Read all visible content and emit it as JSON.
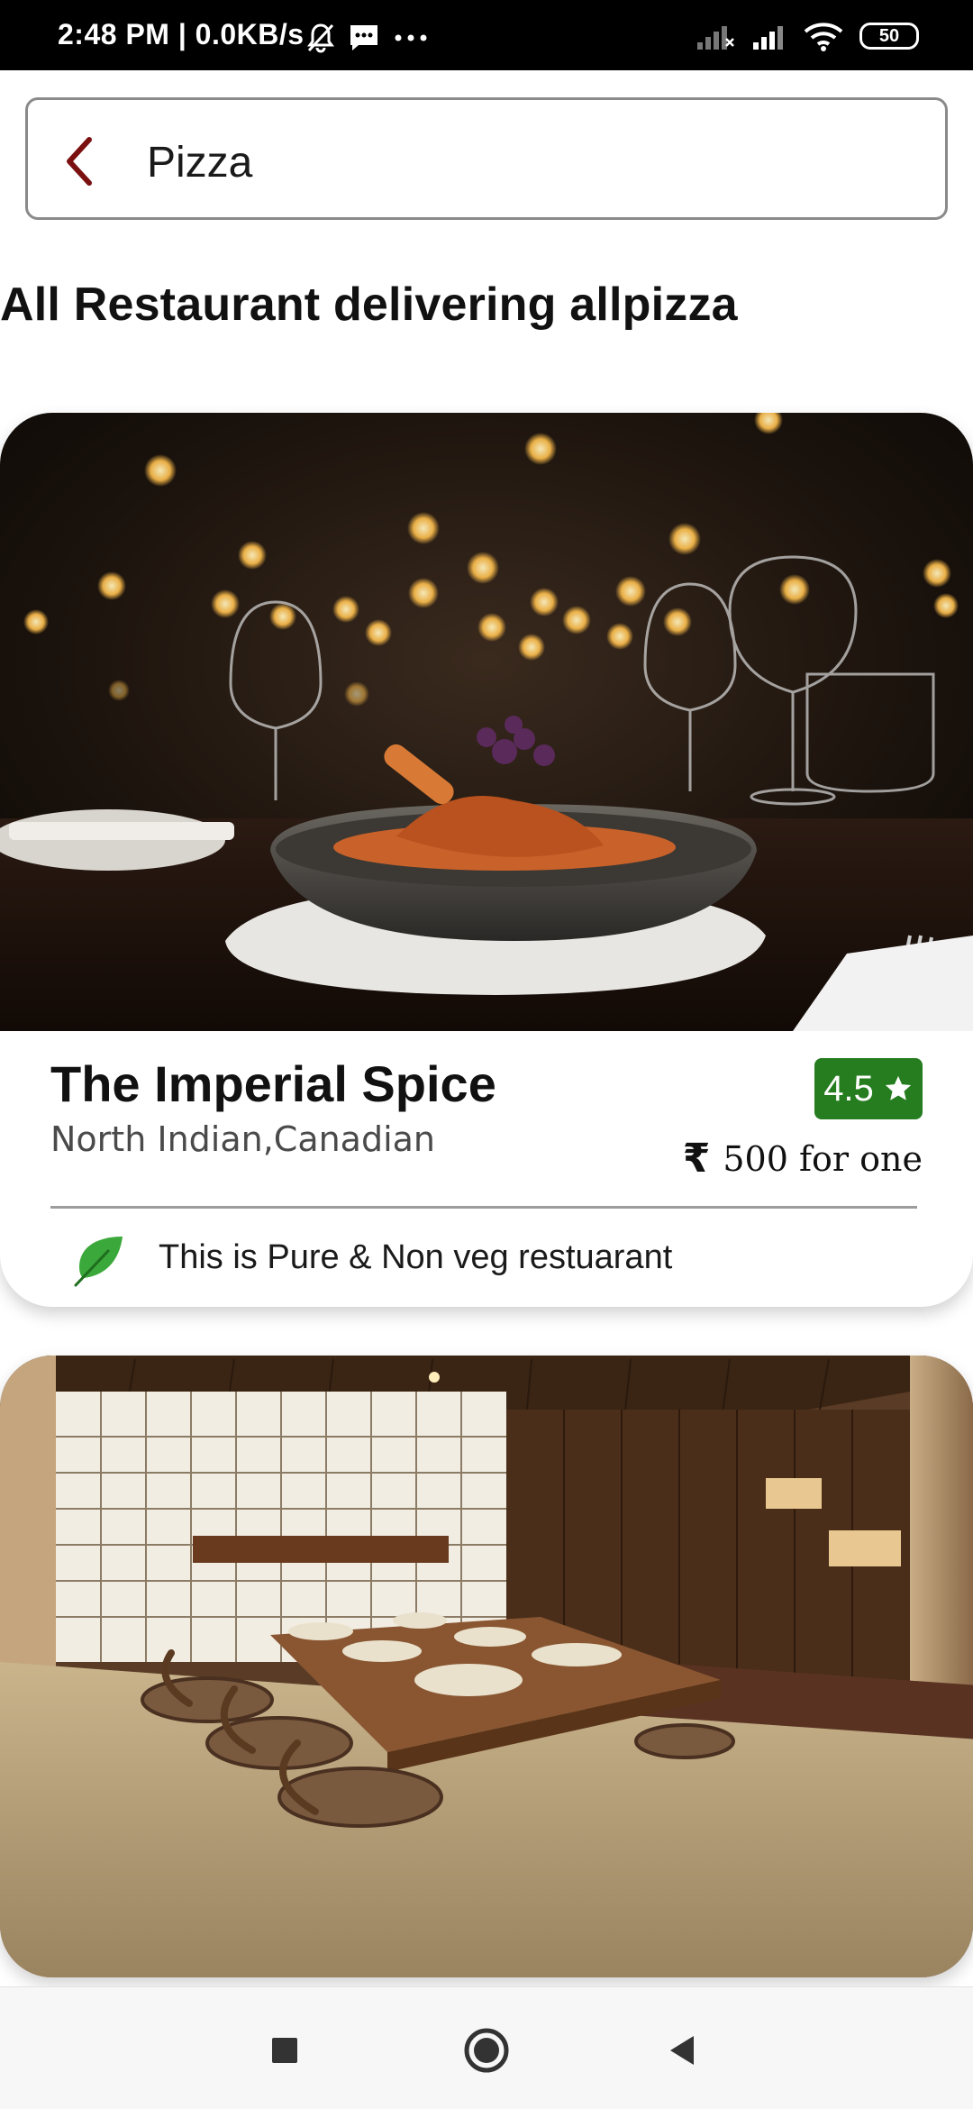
{
  "status_bar": {
    "time_speed": "2:48 PM | 0.0KB/s",
    "battery_level": "50",
    "icons": [
      "mute-bell-icon",
      "message-icon",
      "more-dots-icon",
      "signal-x-icon",
      "signal-icon",
      "wifi-icon",
      "battery-icon"
    ]
  },
  "search": {
    "query": "Pizza",
    "back_icon": "chevron-left-icon"
  },
  "section_title": "All Restaurant delivering allpizza",
  "restaurants": [
    {
      "name": "The Imperial Spice",
      "cuisine": "North Indian,Canadian",
      "rating": "4.5",
      "currency_symbol": "₹",
      "price": "500 for one",
      "tag": "This is Pure & Non veg restuarant",
      "tag_icon": "leaf-icon"
    }
  ],
  "colors": {
    "accent_back": "#7a1010",
    "rating_bg": "#257d1f",
    "leaf": "#3aa83a"
  },
  "nav": {
    "icons": [
      "recent-apps-icon",
      "home-icon",
      "back-triangle-icon"
    ]
  }
}
